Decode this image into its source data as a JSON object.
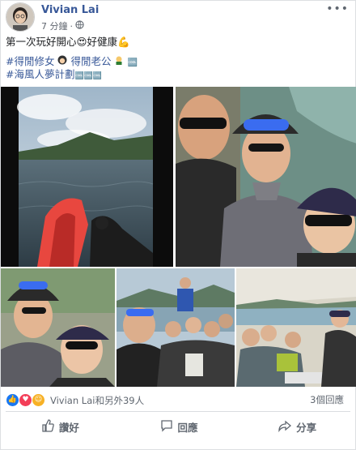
{
  "post": {
    "author": "Vivian Lai",
    "time": "7 分鐘",
    "privacy_icon": "globe-icon",
    "more_icon": "more-dots-icon",
    "text_line1": "第一次玩好開心😍好健康💪",
    "hashtags_line1_a": "#得閒修女",
    "hashtags_line1_b": "得閒老公",
    "hashtags_line1_c": "🆒",
    "hashtag_line2": "#海風人夢計劃",
    "hashtag_line2_suffix": "🆒🆒🆒"
  },
  "photos": [
    {
      "name": "photo-kayak-sea",
      "scene": "kayak-sea"
    },
    {
      "name": "photo-selfie-three",
      "scene": "selfie-three"
    },
    {
      "name": "photo-selfie-two",
      "scene": "selfie-two"
    },
    {
      "name": "photo-group-boat",
      "scene": "group-boat"
    },
    {
      "name": "photo-group-beach",
      "scene": "group-beach"
    }
  ],
  "reactions": {
    "icons": [
      "like-icon",
      "love-icon",
      "haha-icon"
    ],
    "text": "Vivian Lai和另外39人",
    "comments": "3個回應"
  },
  "actions": [
    {
      "label": "讚好",
      "icon": "thumb-up-icon"
    },
    {
      "label": "回應",
      "icon": "comment-icon"
    },
    {
      "label": "分享",
      "icon": "share-icon"
    }
  ],
  "colors": {
    "link": "#385898",
    "muted": "#606770",
    "like": "#1877f2",
    "love": "#f33e58",
    "haha": "#f7b125"
  }
}
